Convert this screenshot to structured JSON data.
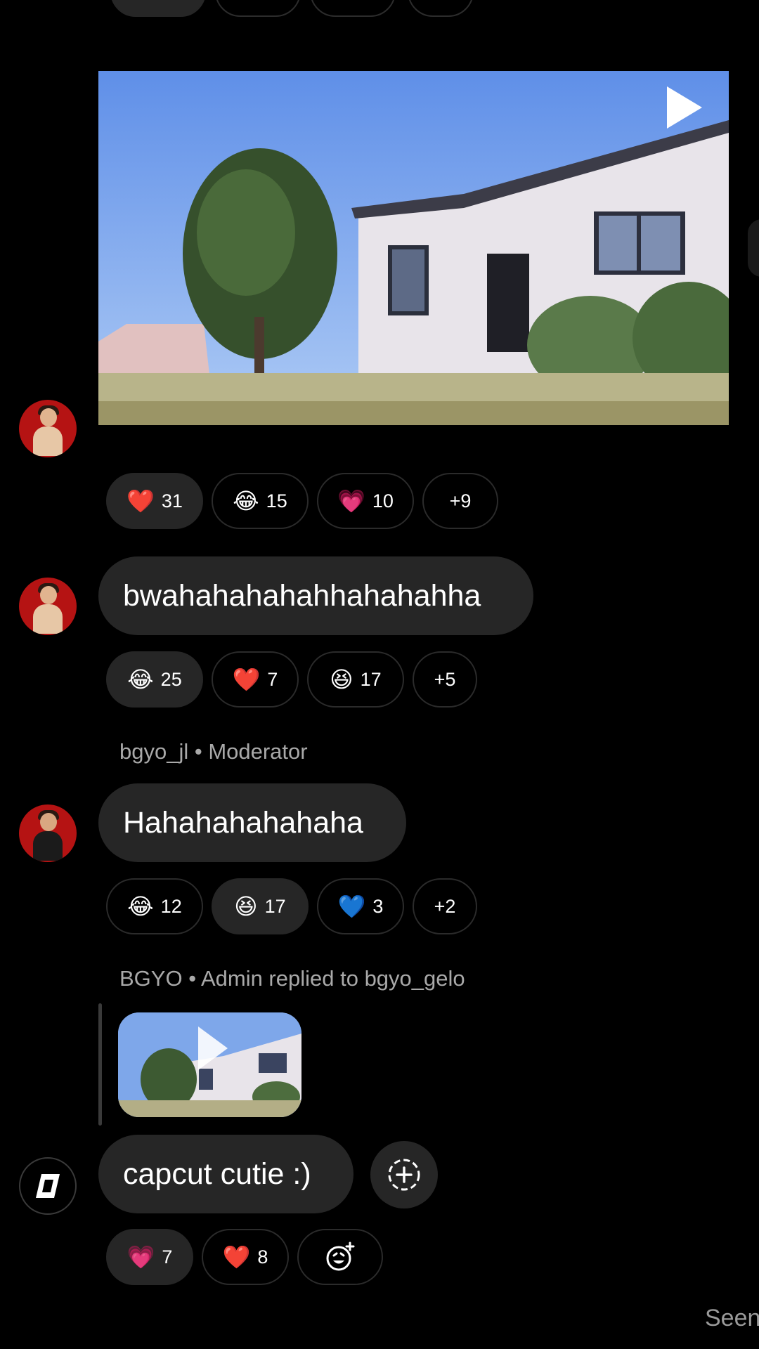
{
  "colors": {
    "background": "#000000",
    "bubble": "#262626",
    "pill_border": "#2b2b2b",
    "meta_text": "#a9a9a9"
  },
  "post1": {
    "type": "video",
    "play_icon": "play-icon",
    "reactions": [
      {
        "emoji": "❤️",
        "count": "31",
        "active": true
      },
      {
        "emoji": "😂",
        "count": "15",
        "active": false
      },
      {
        "emoji": "💗",
        "count": "10",
        "active": false
      },
      {
        "emoji": "",
        "count": "+9",
        "active": false
      }
    ]
  },
  "post2": {
    "text": "bwahahahahahhahahahha",
    "reactions": [
      {
        "emoji": "😂",
        "count": "25",
        "active": true
      },
      {
        "emoji": "❤️",
        "count": "7",
        "active": false
      },
      {
        "emoji": "😆",
        "count": "17",
        "active": false
      },
      {
        "emoji": "",
        "count": "+5",
        "active": false
      }
    ]
  },
  "post3": {
    "sender": "bgyo_jl • Moderator",
    "text": "Hahahahahahaha",
    "reactions": [
      {
        "emoji": "😂",
        "count": "12",
        "active": false
      },
      {
        "emoji": "😆",
        "count": "17",
        "active": true
      },
      {
        "emoji": "💙",
        "count": "3",
        "active": false
      },
      {
        "emoji": "",
        "count": "+2",
        "active": false
      }
    ]
  },
  "post4": {
    "sender": "BGYO • Admin replied to bgyo_gelo",
    "text": "capcut cutie :)",
    "add_reaction_icon": "add-reaction-icon",
    "reactions": [
      {
        "emoji": "💗",
        "count": "7",
        "active": true
      },
      {
        "emoji": "❤️",
        "count": "8",
        "active": false
      }
    ],
    "emoji_picker_icon": "emoji-add-icon"
  },
  "status": {
    "seen": "Seen"
  }
}
